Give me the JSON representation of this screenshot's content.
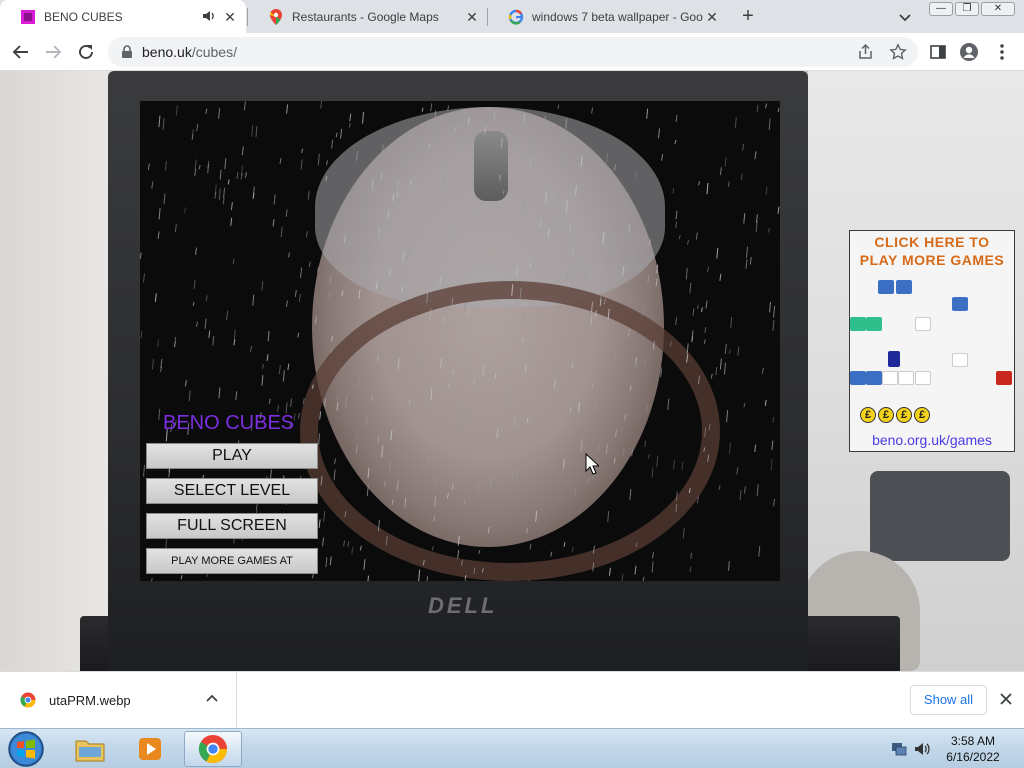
{
  "tabs": [
    {
      "title": "BENO CUBES",
      "active": true,
      "audio": true
    },
    {
      "title": "Restaurants - Google Maps",
      "active": false
    },
    {
      "title": "windows 7 beta wallpaper - Goo",
      "active": false
    }
  ],
  "new_tab_label": "+",
  "window_controls": {
    "minimize": "—",
    "restore": "❐",
    "close": "✕"
  },
  "address": {
    "host": "beno.uk",
    "path": "/cubes/"
  },
  "game": {
    "title": "BENO CUBES",
    "buttons": [
      "PLAY",
      "SELECT LEVEL",
      "FULL SCREEN",
      "PLAY MORE GAMES AT BENO.UK"
    ]
  },
  "ad": {
    "line1": "CLICK HERE TO",
    "line2": "PLAY MORE GAMES",
    "coin_symbol": "£",
    "url": "beno.org.uk/games"
  },
  "laptop_brand": "DELL",
  "download": {
    "filename": "utaPRM.webp",
    "show_all": "Show all"
  },
  "taskbar": {
    "time": "3:58 AM",
    "date": "6/16/2022"
  },
  "colors": {
    "tab_strip": "#dee1e6",
    "game_title": "#7b2fe0",
    "ad_heading": "#d66a18",
    "ad_url": "#4b3be8",
    "link_blue": "#1a73e8"
  }
}
